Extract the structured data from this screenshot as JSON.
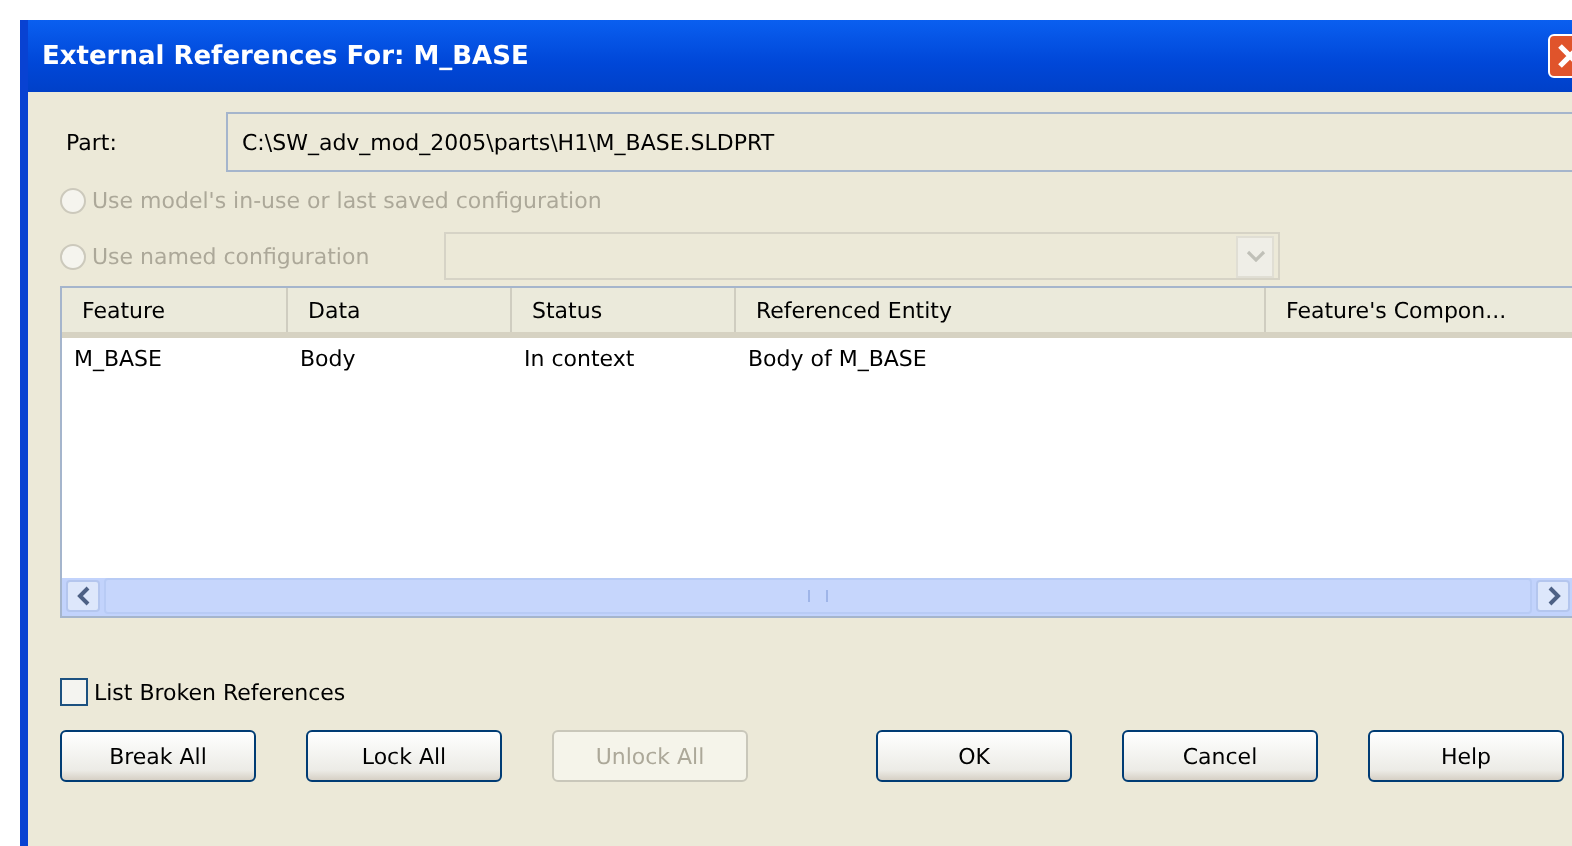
{
  "window": {
    "title": "External References For: M_BASE"
  },
  "part": {
    "label": "Part:",
    "value": "C:\\SW_adv_mod_2005\\parts\\H1\\M_BASE.SLDPRT"
  },
  "configuration_options": [
    {
      "label": "Use model's in-use or last saved configuration",
      "selected": false,
      "disabled": true,
      "kind": "plain"
    },
    {
      "label": "Use named configuration",
      "selected": false,
      "disabled": true,
      "kind": "combo"
    }
  ],
  "table": {
    "columns": [
      "Feature",
      "Data",
      "Status",
      "Referenced Entity",
      "Feature's Compon..."
    ],
    "rows": [
      [
        "M_BASE",
        "Body",
        "In context",
        "Body of M_BASE"
      ]
    ]
  },
  "list_broken_references": {
    "label": "List Broken References",
    "checked": false
  },
  "action_buttons": [
    {
      "label": "Break All",
      "disabled": false
    },
    {
      "label": "Lock All",
      "disabled": false
    },
    {
      "label": "Unlock All",
      "disabled": true
    }
  ],
  "dialog_buttons": [
    {
      "label": "OK",
      "disabled": false
    },
    {
      "label": "Cancel",
      "disabled": false
    },
    {
      "label": "Help",
      "disabled": false
    }
  ]
}
